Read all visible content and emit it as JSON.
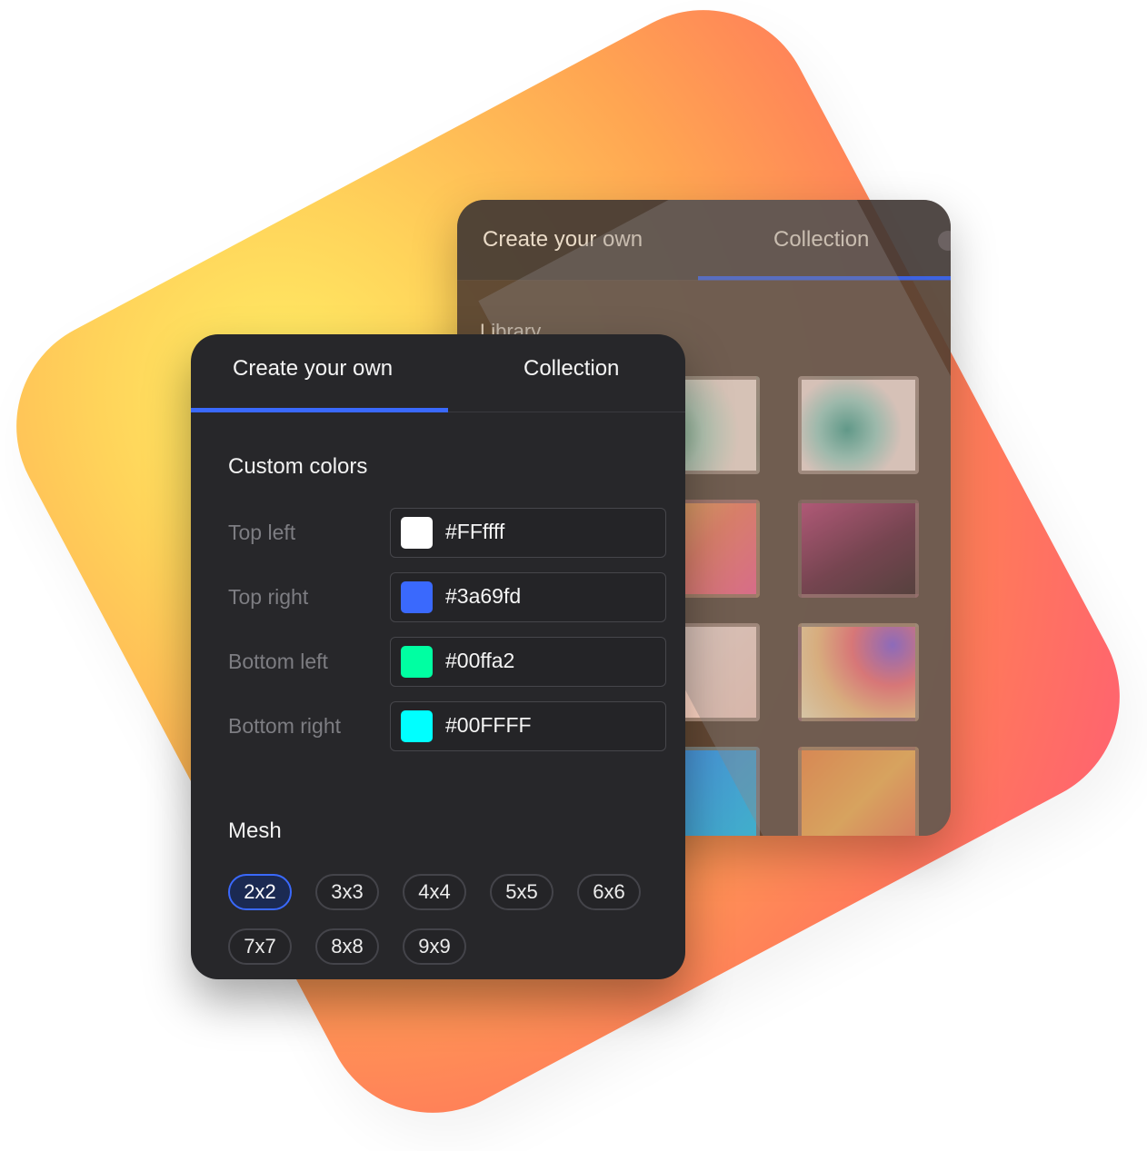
{
  "background": {
    "gradient_colors": [
      "#fff066",
      "#ffa552",
      "#ff5f73"
    ]
  },
  "back_panel": {
    "tabs": [
      {
        "label": "Create your own"
      },
      {
        "label": "Collection"
      }
    ],
    "active_tab": "Collection",
    "section_label": "Library",
    "swatches": [
      {
        "name": "mint-peach"
      },
      {
        "name": "teal-coral"
      },
      {
        "name": "orange-pink"
      },
      {
        "name": "plum-brown"
      },
      {
        "name": "peach"
      },
      {
        "name": "pastel-purple"
      },
      {
        "name": "blue-teal"
      },
      {
        "name": "orange-sunset"
      }
    ]
  },
  "front_panel": {
    "tabs": [
      {
        "label": "Create your own"
      },
      {
        "label": "Collection"
      }
    ],
    "active_tab": "Create your own",
    "custom_colors": {
      "title": "Custom colors",
      "rows": [
        {
          "label": "Top left",
          "value": "#FFffff",
          "color": "#ffffff"
        },
        {
          "label": "Top right",
          "value": "#3a69fd",
          "color": "#3a69fd"
        },
        {
          "label": "Bottom left",
          "value": "#00ffa2",
          "color": "#00ffa2"
        },
        {
          "label": "Bottom right",
          "value": "#00FFFF",
          "color": "#00ffff"
        }
      ]
    },
    "mesh": {
      "title": "Mesh",
      "options": [
        "2x2",
        "3x3",
        "4x4",
        "5x5",
        "6x6",
        "7x7",
        "8x8",
        "9x9"
      ],
      "selected": "2x2"
    },
    "accent_color": "#3a69fd"
  }
}
